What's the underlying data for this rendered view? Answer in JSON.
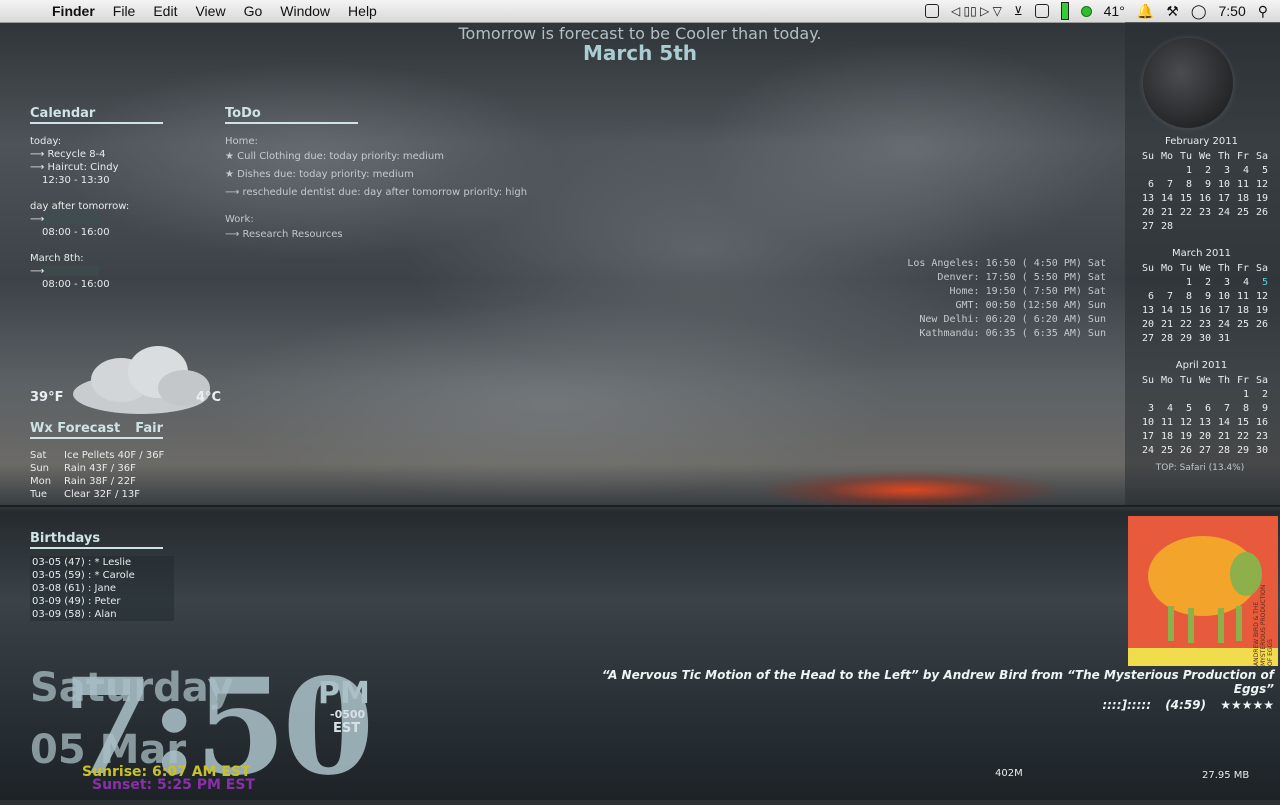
{
  "menubar": {
    "app_name": "Finder",
    "menus": [
      "File",
      "Edit",
      "View",
      "Go",
      "Window",
      "Help"
    ],
    "temperature": "41°",
    "time": "7:50"
  },
  "forecast_banner": {
    "line1": "Tomorrow is forecast to be Cooler than today.",
    "line2": "March  5th"
  },
  "calendar": {
    "title": "Calendar",
    "lines": [
      "today:",
      "⟶ Recycle 8-4",
      "⟶ Haircut: Cindy",
      "12:30 - 13:30",
      "",
      "day after tomorrow:",
      "⟶",
      "08:00 - 16:00",
      "",
      "March 8th:",
      "⟶",
      "08:00 - 16:00"
    ]
  },
  "todo": {
    "title": "ToDo",
    "home_label": "Home:",
    "items": [
      "★ Cull Clothing   due: today   priority: medium",
      "★ Dishes   due: today   priority: medium",
      "⟶ reschedule dentist   due: day after tomorrow   priority: high"
    ],
    "work_label": "Work:",
    "work_items": [
      "⟶ Research Resources"
    ]
  },
  "world_clock": [
    "Los Angeles: 16:50 ( 4:50 PM) Sat",
    "Denver: 17:50 ( 5:50 PM) Sat",
    "Home: 19:50 ( 7:50 PM) Sat",
    "GMT: 00:50 (12:50 AM) Sun",
    "New Delhi: 06:20 ( 6:20 AM) Sun",
    "Kathmandu: 06:35 ( 6:35 AM) Sun"
  ],
  "weather": {
    "temp_f": "39°F",
    "temp_c": "4°C",
    "forecast_title": "Wx Forecast",
    "condition": "Fair",
    "days": [
      {
        "day": "Sat",
        "desc": "Ice Pellets 40F / 36F"
      },
      {
        "day": "Sun",
        "desc": "Rain 43F / 36F"
      },
      {
        "day": "Mon",
        "desc": "Rain 38F / 22F"
      },
      {
        "day": "Tue",
        "desc": "Clear 32F / 13F"
      }
    ]
  },
  "birthdays": {
    "title": "Birthdays",
    "items": [
      "03-05 (47) : * Leslie",
      "03-05 (59) : * Carole",
      "03-08 (61) :   Jane",
      "03-09 (49) :   Peter",
      "03-09 (58) :   Alan"
    ]
  },
  "calendars": [
    {
      "title": "February 2011",
      "header": [
        "Su",
        "Mo",
        "Tu",
        "We",
        "Th",
        "Fr",
        "Sa"
      ],
      "rows": [
        [
          "",
          "",
          "1",
          "2",
          "3",
          "4",
          "5"
        ],
        [
          "6",
          "7",
          "8",
          "9",
          "10",
          "11",
          "12"
        ],
        [
          "13",
          "14",
          "15",
          "16",
          "17",
          "18",
          "19"
        ],
        [
          "20",
          "21",
          "22",
          "23",
          "24",
          "25",
          "26"
        ],
        [
          "27",
          "28",
          "",
          "",
          "",
          "",
          ""
        ]
      ]
    },
    {
      "title": "March 2011",
      "header": [
        "Su",
        "Mo",
        "Tu",
        "We",
        "Th",
        "Fr",
        "Sa"
      ],
      "rows": [
        [
          "",
          "",
          "1",
          "2",
          "3",
          "4",
          "5"
        ],
        [
          "6",
          "7",
          "8",
          "9",
          "10",
          "11",
          "12"
        ],
        [
          "13",
          "14",
          "15",
          "16",
          "17",
          "18",
          "19"
        ],
        [
          "20",
          "21",
          "22",
          "23",
          "24",
          "25",
          "26"
        ],
        [
          "27",
          "28",
          "29",
          "30",
          "31",
          "",
          ""
        ]
      ]
    },
    {
      "title": "April 2011",
      "header": [
        "Su",
        "Mo",
        "Tu",
        "We",
        "Th",
        "Fr",
        "Sa"
      ],
      "rows": [
        [
          "",
          "",
          "",
          "",
          "",
          "1",
          "2"
        ],
        [
          "3",
          "4",
          "5",
          "6",
          "7",
          "8",
          "9"
        ],
        [
          "10",
          "11",
          "12",
          "13",
          "14",
          "15",
          "16"
        ],
        [
          "17",
          "18",
          "19",
          "20",
          "21",
          "22",
          "23"
        ],
        [
          "24",
          "25",
          "26",
          "27",
          "28",
          "29",
          "30"
        ]
      ]
    }
  ],
  "top_process": "TOP: Safari (13.4%)",
  "now_playing": {
    "title_line": "“A Nervous Tic Motion of the Head to the Left” by Andrew Bird from “The Mysterious Production of Eggs”",
    "progress": "::::]:::::",
    "duration": "(4:59)",
    "rating": "★★★★★",
    "album_text": "ANDREW BIRD & THE MYSTERIOUS PRODUCTION OF EGGS"
  },
  "clock": {
    "time": "7:50",
    "ampm": "PM",
    "tz_offset": "-0500",
    "tz": "EST",
    "day": "Saturday",
    "date": "05 Mar",
    "sunrise": "Sunrise: 6:07 AM EST",
    "sunset": "Sunset: 5:25 PM EST"
  },
  "memory_left": "402M",
  "memory_right": "27.95 MB"
}
